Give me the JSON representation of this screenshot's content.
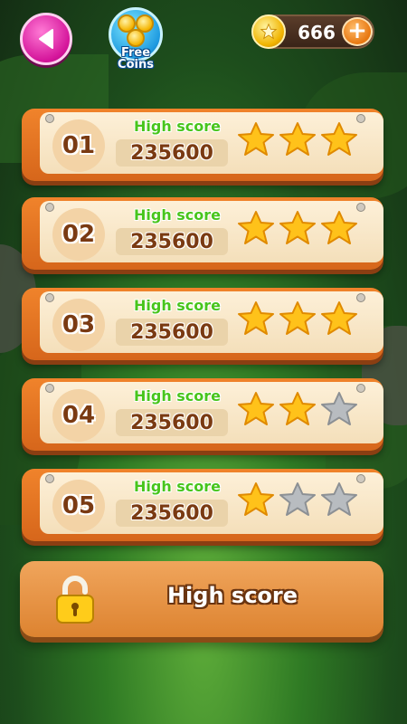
{
  "header": {
    "free_coins_label": "Free Coins",
    "coins": "666",
    "plus": "+"
  },
  "levels": [
    {
      "number": "01",
      "label": "High score",
      "score": "235600",
      "stars": 3
    },
    {
      "number": "02",
      "label": "High score",
      "score": "235600",
      "stars": 3
    },
    {
      "number": "03",
      "label": "High score",
      "score": "235600",
      "stars": 3
    },
    {
      "number": "04",
      "label": "High score",
      "score": "235600",
      "stars": 2
    },
    {
      "number": "05",
      "label": "High score",
      "score": "235600",
      "stars": 1
    }
  ],
  "footer": {
    "button_label": "High score"
  },
  "colors": {
    "star_gold": "#ffc21a",
    "star_gray": "#b8bcc0",
    "accent_green": "#48c51c"
  },
  "icons": [
    "back-arrow-icon",
    "coin-icon",
    "plus-icon",
    "star-icon",
    "lock-icon"
  ]
}
